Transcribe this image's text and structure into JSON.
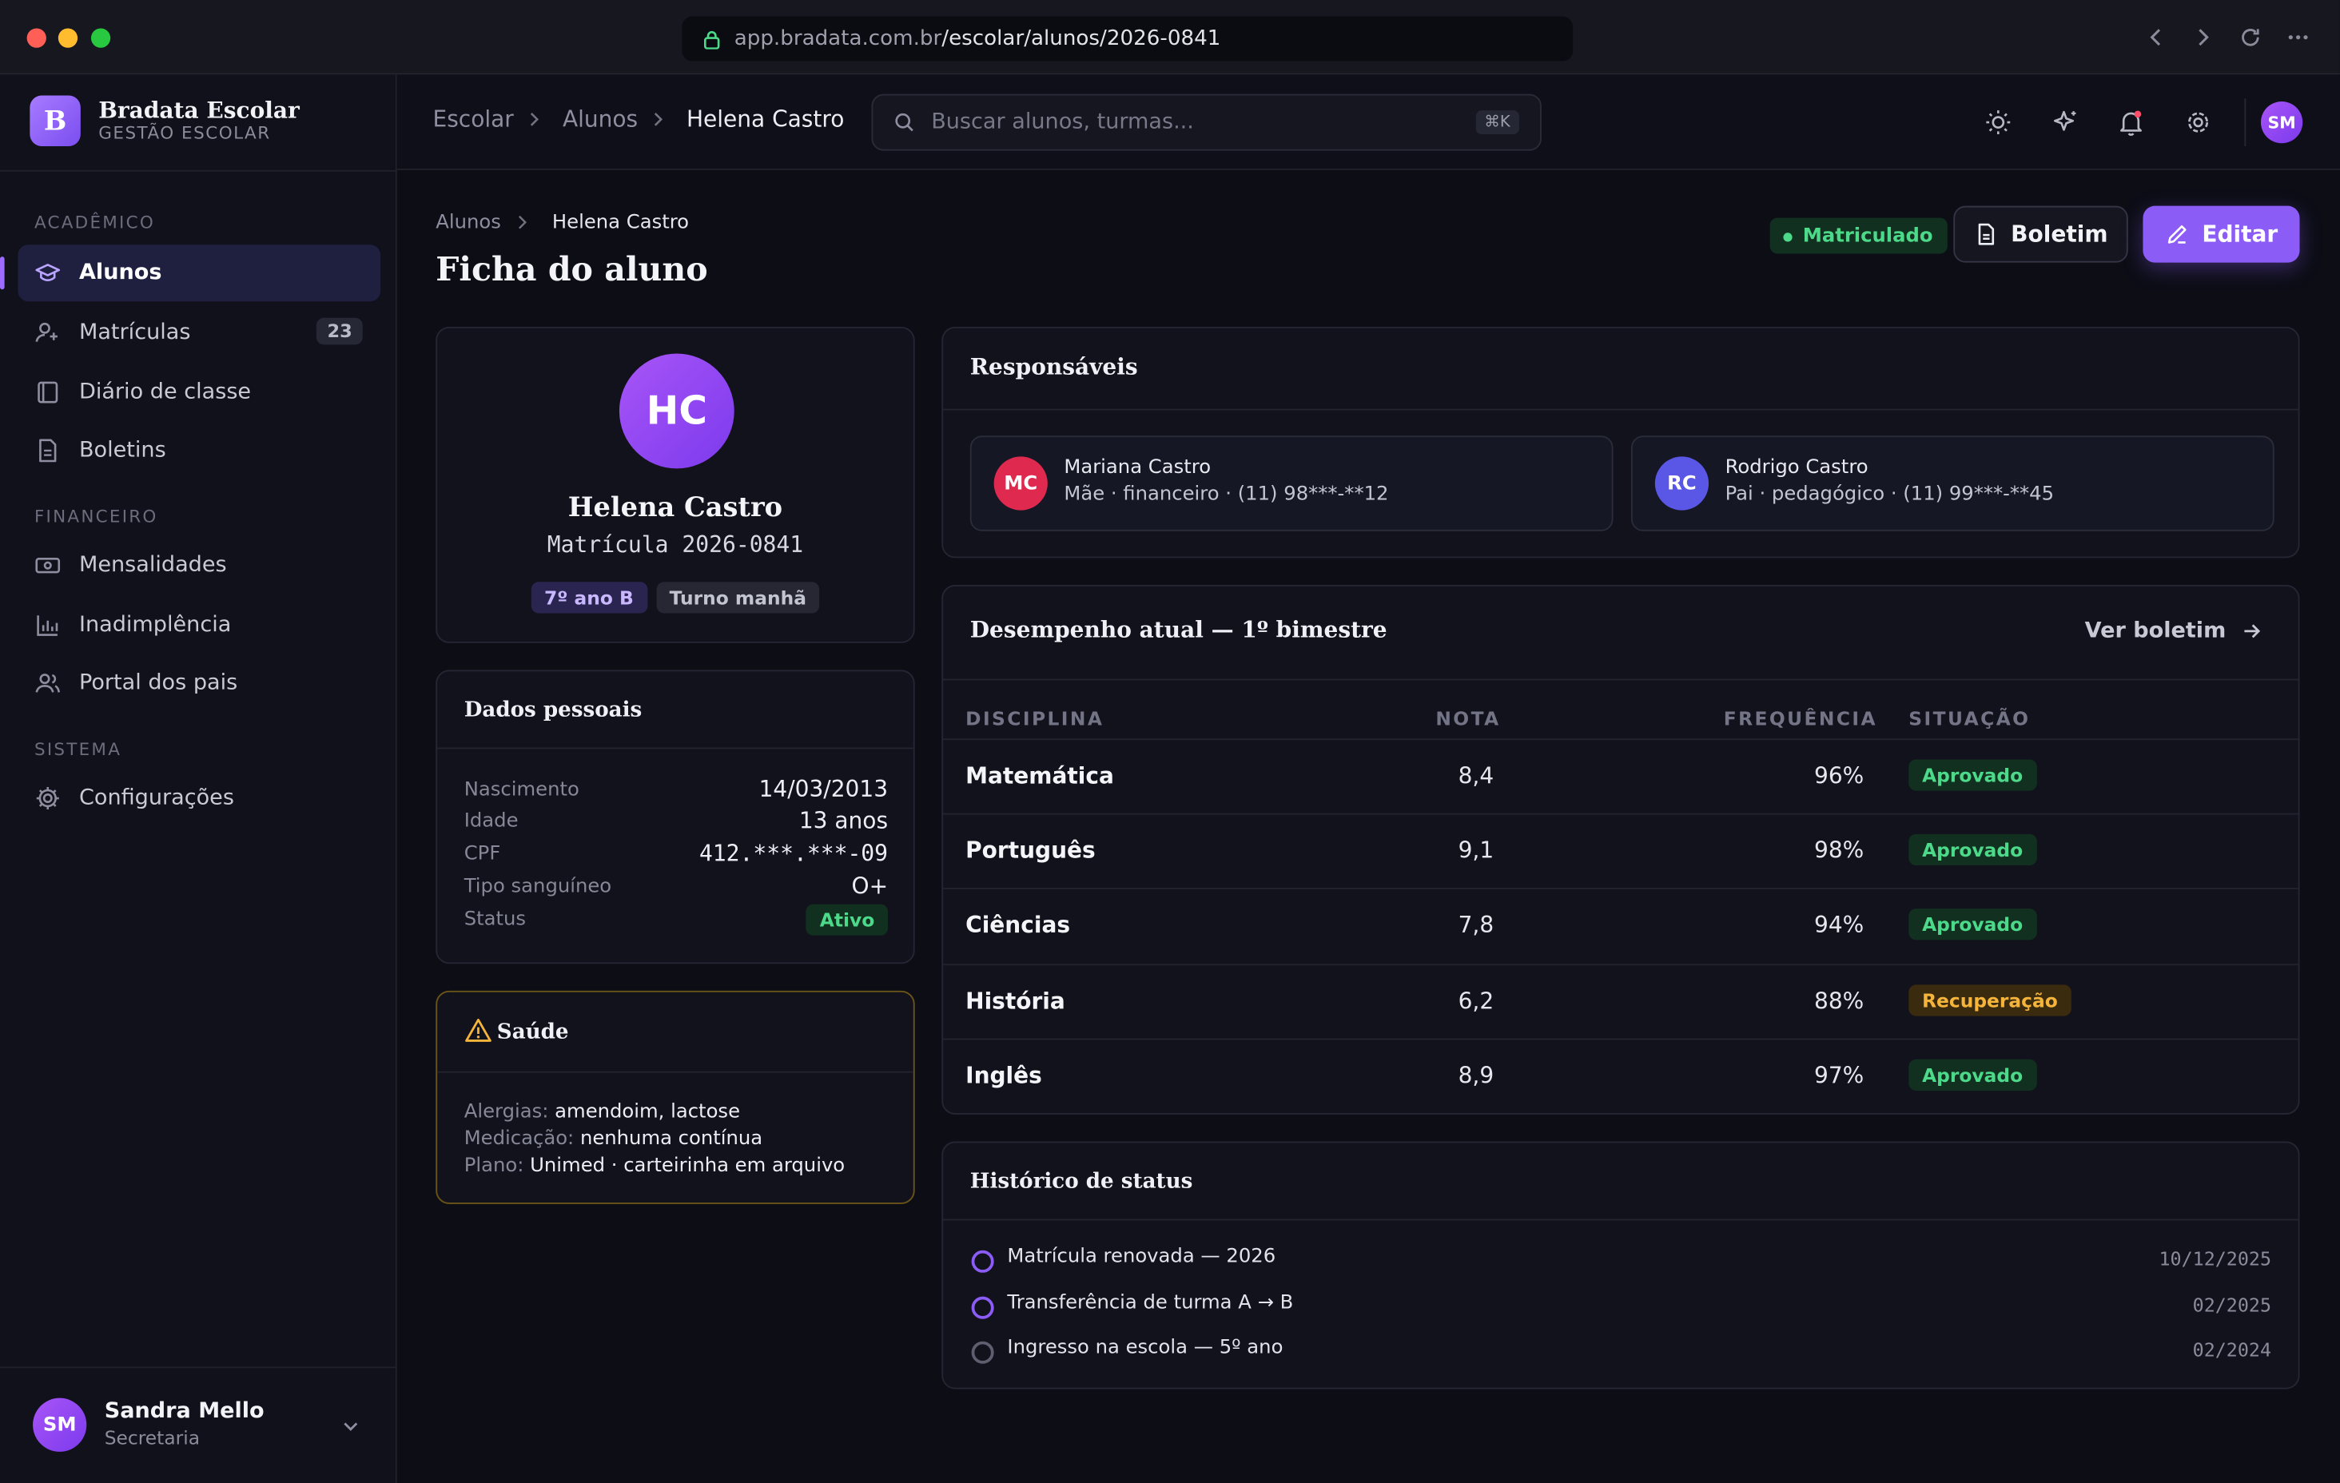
{
  "browser": {
    "url_host": "app.bradata.com.br",
    "url_path": "/escolar/alunos/2026-0841"
  },
  "brand": {
    "logo_letter": "B",
    "name": "Bradata Escolar",
    "subtitle": "GESTÃO ESCOLAR"
  },
  "sidebar": {
    "sections": [
      {
        "title": "ACADÊMICO",
        "items": [
          {
            "label": "Alunos",
            "icon": "graduation-cap-icon",
            "active": true
          },
          {
            "label": "Matrículas",
            "icon": "user-plus-icon",
            "badge": "23"
          },
          {
            "label": "Diário de classe",
            "icon": "notebook-icon"
          },
          {
            "label": "Boletins",
            "icon": "file-icon"
          }
        ]
      },
      {
        "title": "FINANCEIRO",
        "items": [
          {
            "label": "Mensalidades",
            "icon": "cash-icon"
          },
          {
            "label": "Inadimplência",
            "icon": "bar-chart-icon"
          },
          {
            "label": "Portal dos pais",
            "icon": "users-icon"
          }
        ]
      },
      {
        "title": "SISTEMA",
        "items": [
          {
            "label": "Configurações",
            "icon": "gear-icon"
          }
        ]
      }
    ],
    "user": {
      "initials": "SM",
      "name": "Sandra Mello",
      "role": "Secretaria"
    }
  },
  "topbar": {
    "breadcrumb": [
      "Escolar",
      "Alunos",
      "Helena Castro"
    ],
    "search_placeholder": "Buscar alunos, turmas...",
    "search_shortcut": "⌘K",
    "avatar_initials": "SM"
  },
  "page": {
    "breadcrumb": [
      "Alunos",
      "Helena Castro"
    ],
    "title": "Ficha do aluno",
    "status_pill": "Matriculado",
    "boletim_button": "Boletim",
    "edit_button": "Editar"
  },
  "profile": {
    "initials": "HC",
    "name": "Helena Castro",
    "enrollment": "Matrícula 2026-0841",
    "class_tag": "7º ano B",
    "shift_tag": "Turno manhã"
  },
  "personal": {
    "title": "Dados pessoais",
    "rows": [
      {
        "label": "Nascimento",
        "value": "14/03/2013"
      },
      {
        "label": "Idade",
        "value": "13 anos"
      },
      {
        "label": "CPF",
        "value": "412.***.***-09"
      },
      {
        "label": "Tipo sanguíneo",
        "value": "O+"
      },
      {
        "label": "Status",
        "value": "Ativo"
      }
    ]
  },
  "health": {
    "title": "Saúde",
    "rows": [
      {
        "label": "Alergias:",
        "value": "amendoim, lactose"
      },
      {
        "label": "Medicação:",
        "value": "nenhuma contínua"
      },
      {
        "label": "Plano:",
        "value": "Unimed · carteirinha em arquivo"
      }
    ]
  },
  "guardians": {
    "title": "Responsáveis",
    "items": [
      {
        "initials": "MC",
        "name": "Mariana Castro",
        "info": "Mãe · financeiro · (11) 98***-**12",
        "color": "#e0294f"
      },
      {
        "initials": "RC",
        "name": "Rodrigo Castro",
        "info": "Pai · pedagógico · (11) 99***-**45",
        "color": "#5b57e6"
      }
    ]
  },
  "performance": {
    "title": "Desempenho atual — 1º bimestre",
    "link": "Ver boletim",
    "columns": [
      "DISCIPLINA",
      "NOTA",
      "FREQUÊNCIA",
      "SITUAÇÃO"
    ],
    "rows": [
      {
        "subject": "Matemática",
        "grade": "8,4",
        "attendance": "96%",
        "status": "Aprovado",
        "kind": "ok"
      },
      {
        "subject": "Português",
        "grade": "9,1",
        "attendance": "98%",
        "status": "Aprovado",
        "kind": "ok"
      },
      {
        "subject": "Ciências",
        "grade": "7,8",
        "attendance": "94%",
        "status": "Aprovado",
        "kind": "ok"
      },
      {
        "subject": "História",
        "grade": "6,2",
        "attendance": "88%",
        "status": "Recuperação",
        "kind": "warn"
      },
      {
        "subject": "Inglês",
        "grade": "8,9",
        "attendance": "97%",
        "status": "Aprovado",
        "kind": "ok"
      }
    ]
  },
  "history": {
    "title": "Histórico de status",
    "items": [
      {
        "text": "Matrícula renovada — 2026",
        "date": "10/12/2025"
      },
      {
        "text": "Transferência de turma A → B",
        "date": "02/2025"
      },
      {
        "text": "Ingresso na escola — 5º ano",
        "date": "02/2024"
      }
    ]
  },
  "colors": {
    "accent": "#8b5cf6",
    "ok": "#4cd98a",
    "warn": "#f5b43a"
  }
}
